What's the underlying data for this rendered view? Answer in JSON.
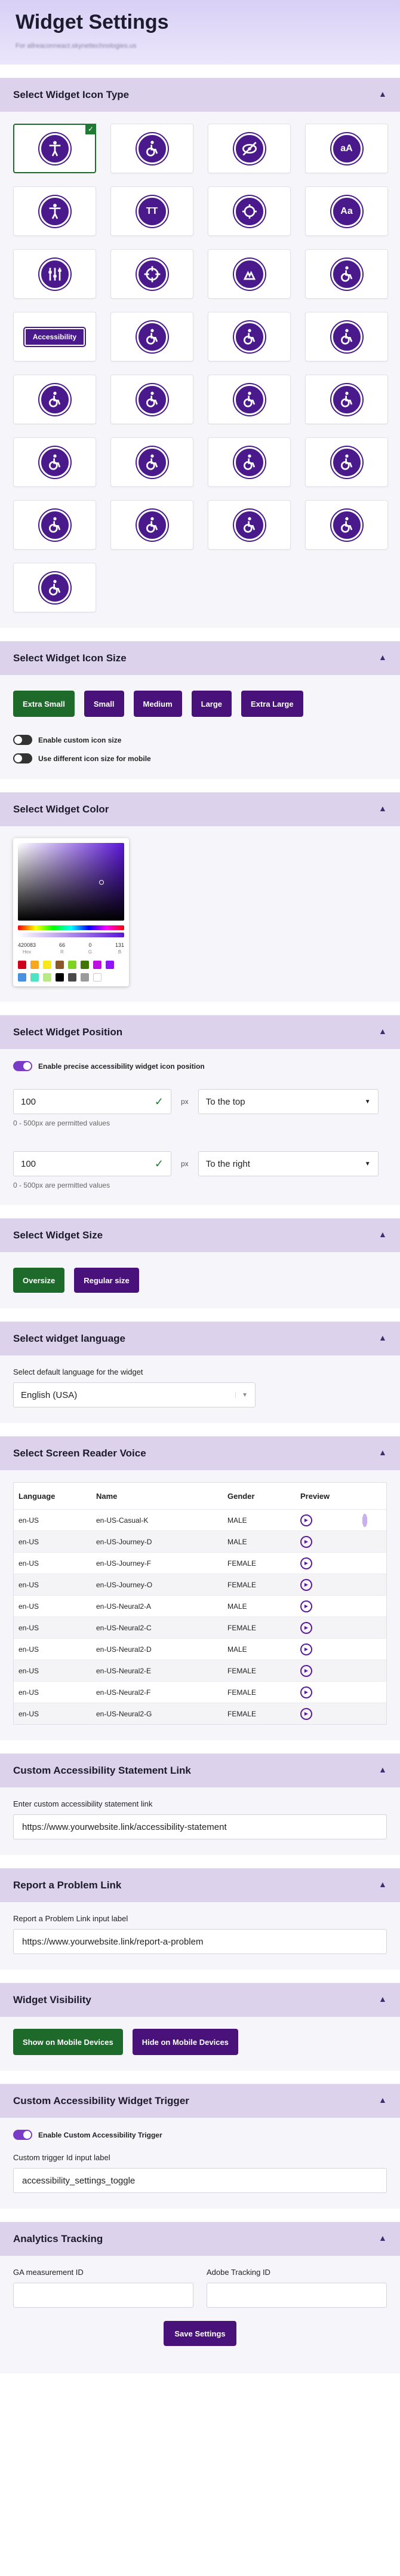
{
  "header": {
    "title": "Widget Settings",
    "subtitle": "For allreaconneact.skynettechnologies.us"
  },
  "icon_type": {
    "title": "Select Widget Icon Type",
    "pill_label": "Accessibility",
    "selected_index": 0
  },
  "icon_size": {
    "title": "Select Widget Icon Size",
    "buttons": [
      "Extra Small",
      "Small",
      "Medium",
      "Large",
      "Extra Large"
    ],
    "selected": "Extra Small",
    "toggle1": "Enable custom icon size",
    "toggle2": "Use different icon size for mobile"
  },
  "color": {
    "title": "Select Widget Color",
    "hex": "420083",
    "r": "66",
    "g": "0",
    "b": "131",
    "hex_label": "Hex",
    "r_label": "R",
    "g_label": "G",
    "b_label": "B",
    "swatches": [
      "#d0021b",
      "#f5a623",
      "#f8e71c",
      "#8b572a",
      "#7ed321",
      "#417505",
      "#bd10e0",
      "#9013fe",
      "#4a90e2",
      "#50e3c2",
      "#b8e986",
      "#000000",
      "#4a4a4a",
      "#9b9b9b",
      "#ffffff"
    ]
  },
  "position": {
    "title": "Select Widget Position",
    "toggle": "Enable precise accessibility widget icon position",
    "vertical_value": "100",
    "unit": "px",
    "vertical_dir": "To the top",
    "hint": "0 - 500px are permitted values",
    "horizontal_value": "100",
    "horizontal_dir": "To the right"
  },
  "size": {
    "title": "Select Widget Size",
    "oversize": "Oversize",
    "regular": "Regular size"
  },
  "language": {
    "title": "Select widget language",
    "label": "Select default language for the widget",
    "value": "English (USA)"
  },
  "voice": {
    "title": "Select Screen Reader Voice",
    "headers": [
      "Language",
      "Name",
      "Gender",
      "Preview"
    ],
    "rows": [
      {
        "lang": "en-US",
        "name": "en-US-Casual-K",
        "gender": "MALE"
      },
      {
        "lang": "en-US",
        "name": "en-US-Journey-D",
        "gender": "MALE"
      },
      {
        "lang": "en-US",
        "name": "en-US-Journey-F",
        "gender": "FEMALE"
      },
      {
        "lang": "en-US",
        "name": "en-US-Journey-O",
        "gender": "FEMALE"
      },
      {
        "lang": "en-US",
        "name": "en-US-Neural2-A",
        "gender": "MALE"
      },
      {
        "lang": "en-US",
        "name": "en-US-Neural2-C",
        "gender": "FEMALE"
      },
      {
        "lang": "en-US",
        "name": "en-US-Neural2-D",
        "gender": "MALE"
      },
      {
        "lang": "en-US",
        "name": "en-US-Neural2-E",
        "gender": "FEMALE"
      },
      {
        "lang": "en-US",
        "name": "en-US-Neural2-F",
        "gender": "FEMALE"
      },
      {
        "lang": "en-US",
        "name": "en-US-Neural2-G",
        "gender": "FEMALE"
      }
    ]
  },
  "statement": {
    "title": "Custom Accessibility Statement Link",
    "label": "Enter custom accessibility statement link",
    "value": "https://www.yourwebsite.link/accessibility-statement"
  },
  "problem": {
    "title": "Report a Problem Link",
    "label": "Report a Problem Link input label",
    "value": "https://www.yourwebsite.link/report-a-problem"
  },
  "visibility": {
    "title": "Widget Visibility",
    "show": "Show on Mobile Devices",
    "hide": "Hide on Mobile Devices"
  },
  "trigger": {
    "title": "Custom Accessibility Widget Trigger",
    "toggle": "Enable Custom Accessibility Trigger",
    "label": "Custom trigger Id input label",
    "value": "accessibility_settings_toggle"
  },
  "analytics": {
    "title": "Analytics Tracking",
    "ga_label": "GA measurement ID",
    "adobe_label": "Adobe Tracking ID"
  },
  "save_label": "Save Settings"
}
